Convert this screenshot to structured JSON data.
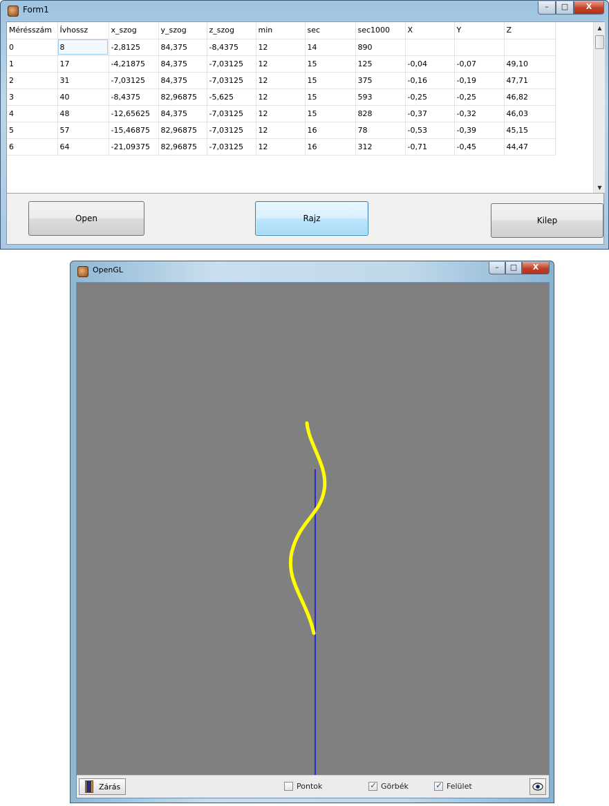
{
  "form1": {
    "title": "Form1",
    "window_buttons": {
      "minimize": "–",
      "maximize": "□",
      "close": "X"
    },
    "grid": {
      "columns": [
        "Mérésszám",
        "Ívhossz",
        "x_szog",
        "y_szog",
        "z_szog",
        "min",
        "sec",
        "sec1000",
        "X",
        "Y",
        "Z"
      ],
      "rows": [
        [
          "0",
          "8",
          "-2,8125",
          "84,375",
          "-8,4375",
          "12",
          "14",
          "890",
          "",
          "",
          ""
        ],
        [
          "1",
          "17",
          "-4,21875",
          "84,375",
          "-7,03125",
          "12",
          "15",
          "125",
          "-0,04",
          "-0,07",
          "49,10"
        ],
        [
          "2",
          "31",
          "-7,03125",
          "84,375",
          "-7,03125",
          "12",
          "15",
          "375",
          "-0,16",
          "-0,19",
          "47,71"
        ],
        [
          "3",
          "40",
          "-8,4375",
          "82,96875",
          "-5,625",
          "12",
          "15",
          "593",
          "-0,25",
          "-0,25",
          "46,82"
        ],
        [
          "4",
          "48",
          "-12,65625",
          "84,375",
          "-7,03125",
          "12",
          "15",
          "828",
          "-0,37",
          "-0,32",
          "46,03"
        ],
        [
          "5",
          "57",
          "-15,46875",
          "82,96875",
          "-7,03125",
          "12",
          "16",
          "78",
          "-0,53",
          "-0,39",
          "45,15"
        ],
        [
          "6",
          "64",
          "-21,09375",
          "82,96875",
          "-7,03125",
          "12",
          "16",
          "312",
          "-0,71",
          "-0,45",
          "44,47"
        ]
      ],
      "scroll_up": "▲",
      "scroll_down": "▼"
    },
    "buttons": {
      "open": "Open",
      "rajz": "Rajz",
      "kilep": "Kilep"
    }
  },
  "opengl": {
    "title": "OpenGL",
    "window_buttons": {
      "minimize": "–",
      "maximize": "□",
      "close": "X"
    },
    "colors": {
      "background": "#808080",
      "curve": "#ffff00",
      "axis": "#2a2ad0"
    },
    "status": {
      "close_label": "Zárás",
      "checkboxes": [
        {
          "label": "Pontok",
          "checked": false
        },
        {
          "label": "Görbék",
          "checked": true
        },
        {
          "label": "Felület",
          "checked": true
        }
      ]
    }
  }
}
